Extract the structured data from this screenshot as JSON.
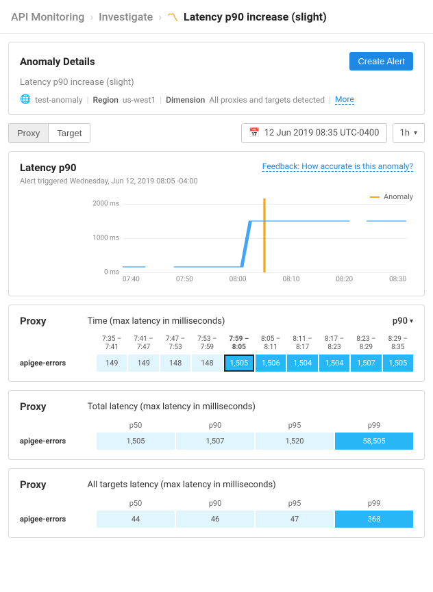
{
  "breadcrumb": {
    "root": "API Monitoring",
    "mid": "Investigate",
    "leaf": "Latency p90 increase (slight)"
  },
  "details": {
    "title": "Anomaly Details",
    "create_alert": "Create Alert",
    "subtitle": "Latency p90 increase (slight)",
    "env": "test-anomaly",
    "region_label": "Region",
    "region_value": "us-west1",
    "dimension_label": "Dimension",
    "dimension_value": "All proxies and targets detected",
    "more": "More"
  },
  "toolbar": {
    "proxy_tab": "Proxy",
    "target_tab": "Target",
    "datetime": "12 Jun 2019 08:35 UTC-0400",
    "range": "1h"
  },
  "chart": {
    "title": "Latency p90",
    "feedback": "Feedback: How accurate is this anomaly?",
    "alert_triggered": "Alert triggered Wednesday, Jun 12, 2019 08:05 -04:00",
    "legend_anomaly": "Anomaly",
    "ylabels": {
      "top": "2000 ms",
      "mid": "1000 ms",
      "bot": "0 ms"
    },
    "xlabels": [
      "07:40",
      "07:50",
      "08:00",
      "08:10",
      "08:20",
      "08:30"
    ]
  },
  "time_table": {
    "left_label": "Proxy",
    "mid_label": "Time (max latency in milliseconds)",
    "dropdown": "p90",
    "columns": [
      {
        "t1": "7:35 –",
        "t2": "7:41"
      },
      {
        "t1": "7:41 –",
        "t2": "7:47"
      },
      {
        "t1": "7:47 –",
        "t2": "7:53"
      },
      {
        "t1": "7:53 –",
        "t2": "7:59"
      },
      {
        "t1": "7:59 –",
        "t2": "8:05",
        "bold": true
      },
      {
        "t1": "8:05 –",
        "t2": "8:11"
      },
      {
        "t1": "8:11 –",
        "t2": "8:17"
      },
      {
        "t1": "8:17 –",
        "t2": "8:23"
      },
      {
        "t1": "8:23 –",
        "t2": "8:29"
      },
      {
        "t1": "8:29 –",
        "t2": "8:35"
      }
    ],
    "row_label": "apigee-errors",
    "values": [
      "149",
      "149",
      "148",
      "148",
      "1,505",
      "1,506",
      "1,504",
      "1,504",
      "1,507",
      "1,505"
    ]
  },
  "total_latency": {
    "left_label": "Proxy",
    "mid_label": "Total latency (max latency in milliseconds)",
    "columns": [
      "p50",
      "p90",
      "p95",
      "p99"
    ],
    "row_label": "apigee-errors",
    "values": [
      "1,505",
      "1,507",
      "1,520",
      "58,505"
    ]
  },
  "all_targets": {
    "left_label": "Proxy",
    "mid_label": "All targets latency (max latency in milliseconds)",
    "columns": [
      "p50",
      "p90",
      "p95",
      "p99"
    ],
    "row_label": "apigee-errors",
    "values": [
      "44",
      "46",
      "47",
      "368"
    ]
  },
  "chart_data": {
    "type": "line",
    "title": "Latency p90",
    "ylabel": "ms",
    "ylim": [
      0,
      2000
    ],
    "x": [
      "07:35",
      "07:40",
      "07:45",
      "07:50",
      "07:55",
      "08:00",
      "08:05",
      "08:10",
      "08:15",
      "08:20",
      "08:25",
      "08:30",
      "08:35"
    ],
    "series": [
      {
        "name": "Latency p90",
        "values": [
          150,
          150,
          null,
          150,
          150,
          150,
          1500,
          1500,
          1500,
          1500,
          null,
          1500,
          1500
        ]
      }
    ],
    "anomaly_marker_x": "08:05",
    "legend": [
      "Anomaly"
    ]
  }
}
